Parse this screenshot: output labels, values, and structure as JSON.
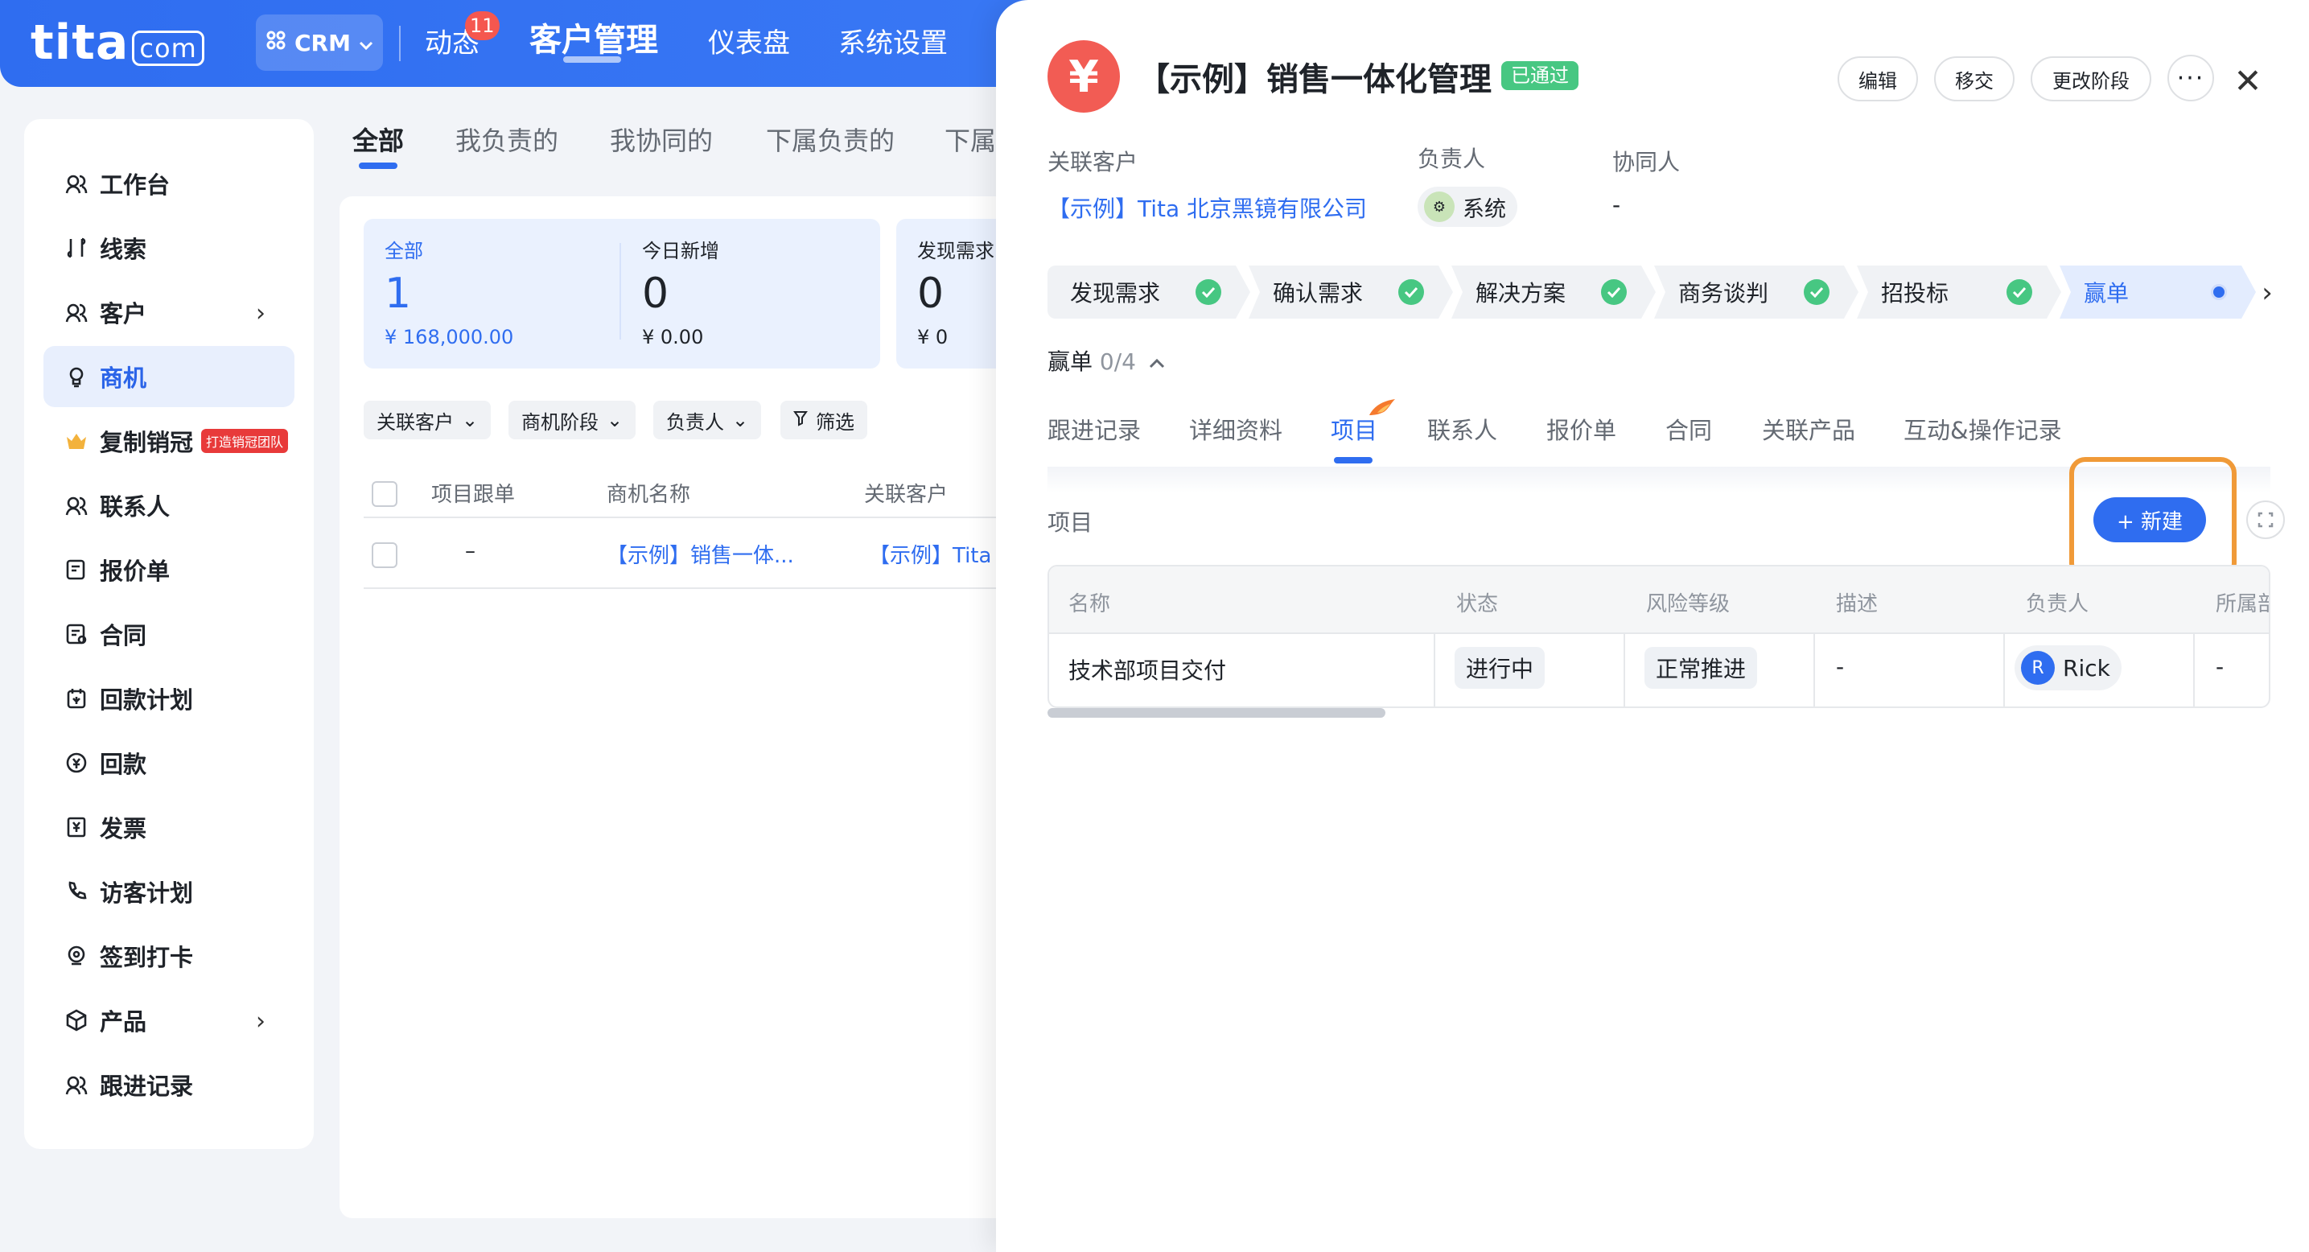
{
  "header": {
    "logo_text": "tita",
    "logo_suffix": "com",
    "crm_label": "CRM",
    "nav": [
      "动态",
      "客户管理",
      "仪表盘",
      "系统设置"
    ],
    "notification_count": "11"
  },
  "sidebar": {
    "items": [
      {
        "label": "工作台",
        "icon": "workbench-icon"
      },
      {
        "label": "线索",
        "icon": "lead-icon"
      },
      {
        "label": "客户",
        "icon": "customer-icon"
      },
      {
        "label": "商机",
        "icon": "bulb-icon"
      },
      {
        "label": "复制销冠",
        "icon": "crown-icon",
        "tag": "打造销冠团队"
      },
      {
        "label": "联系人",
        "icon": "contact-icon"
      },
      {
        "label": "报价单",
        "icon": "quote-icon"
      },
      {
        "label": "合同",
        "icon": "contract-icon"
      },
      {
        "label": "回款计划",
        "icon": "payment-plan-icon"
      },
      {
        "label": "回款",
        "icon": "payment-icon"
      },
      {
        "label": "发票",
        "icon": "invoice-icon"
      },
      {
        "label": "访客计划",
        "icon": "phone-icon"
      },
      {
        "label": "签到打卡",
        "icon": "location-icon"
      },
      {
        "label": "产品",
        "icon": "product-icon"
      },
      {
        "label": "跟进记录",
        "icon": "followup-icon"
      }
    ]
  },
  "list": {
    "tabs": [
      "全部",
      "我负责的",
      "我协同的",
      "下属负责的",
      "下属"
    ],
    "stats": [
      {
        "label": "全部",
        "count": "1",
        "amount": "¥ 168,000.00"
      },
      {
        "label": "今日新增",
        "count": "0",
        "amount": "¥ 0.00"
      },
      {
        "label": "发现需求",
        "count": "0",
        "amount": "¥ 0"
      }
    ],
    "filters": [
      "关联客户",
      "商机阶段",
      "负责人",
      "筛选"
    ],
    "columns": [
      "项目跟单",
      "商机名称",
      "关联客户"
    ],
    "row": {
      "project": "–",
      "name": "【示例】销售一体...",
      "customer": "【示例】Tita :"
    }
  },
  "drawer": {
    "icon_char": "¥",
    "title": "【示例】销售一体化管理",
    "status": "已通过",
    "actions": [
      "编辑",
      "移交",
      "更改阶段"
    ],
    "meta": {
      "customer_label": "关联客户",
      "customer_value": "【示例】Tita 北京黑镜有限公司",
      "owner_label": "负责人",
      "owner_value": "系统",
      "collab_label": "协同人",
      "collab_value": "-"
    },
    "stages": [
      "发现需求",
      "确认需求",
      "解决方案",
      "商务谈判",
      "招投标",
      "赢单"
    ],
    "current_stage": "赢单",
    "current_stage_progress": "0/4",
    "tabs": [
      "跟进记录",
      "详细资料",
      "项目",
      "联系人",
      "报价单",
      "合同",
      "关联产品",
      "互动&操作记录"
    ],
    "active_tab": "项目",
    "section_title": "项目",
    "new_button": "+ 新建",
    "project_table": {
      "columns": [
        "名称",
        "状态",
        "风险等级",
        "描述",
        "负责人",
        "所属部"
      ],
      "row": {
        "name": "技术部项目交付",
        "status": "进行中",
        "risk": "正常推进",
        "desc": "-",
        "owner_initial": "R",
        "owner": "Rick",
        "dept": "-"
      }
    }
  }
}
